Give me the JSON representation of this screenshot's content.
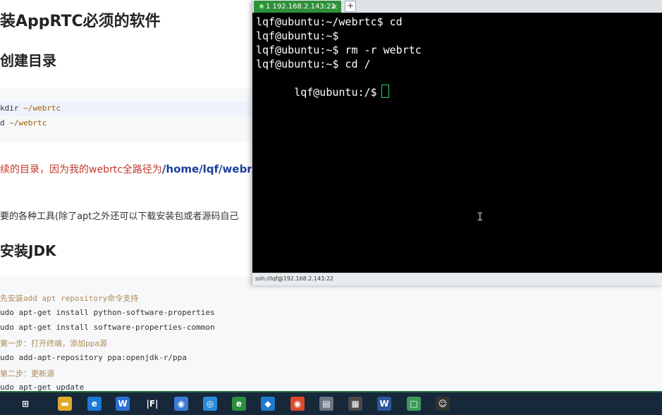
{
  "doc": {
    "heading_main": "装AppRTC必须的软件",
    "heading_dir": "创建目录",
    "dir_code": [
      {
        "cmd": "kdir ",
        "path": "~/webrtc"
      },
      {
        "cmd": "d ",
        "path": "~/webrtc"
      }
    ],
    "red_note": "续的目录，因为我的webrtc全路径为",
    "red_note_path": "/home/lqf/webrtc",
    "note2": "要的各种工具(除了apt之外还可以下载安装包或者源码自己",
    "heading_jdk": "安装JDK",
    "jdk_code": [
      {
        "text": "先安装add apt repository命令支持",
        "comment": true
      },
      {
        "text": "udo apt-get install python-software-properties",
        "comment": false
      },
      {
        "text": "udo apt-get install software-properties-common",
        "comment": false
      },
      {
        "text": "第一步：打开终端，添加ppa源",
        "comment": true
      },
      {
        "text": "udo add-apt-repository ppa:openjdk-r/ppa",
        "comment": false
      },
      {
        "text": "第二步：更新源",
        "comment": true
      },
      {
        "text": "udo apt-get update",
        "comment": false
      }
    ]
  },
  "terminal": {
    "tab_label": "1 192.168.2.143:22",
    "tab_close": "×",
    "tab_add": "+",
    "lines": [
      "lqf@ubuntu:~/webrtc$ cd",
      "lqf@ubuntu:~$",
      "lqf@ubuntu:~$ rm -r webrtc",
      "lqf@ubuntu:~$ cd /",
      "lqf@ubuntu:/$"
    ],
    "status": "ssh://lqf@192.168.2.143:22",
    "ibeam": "I"
  },
  "taskbar": {
    "items": [
      {
        "name": "task-view-icon",
        "glyph": "⊞",
        "color": "#16283a"
      },
      {
        "name": "file-explorer-icon",
        "glyph": "▬",
        "color": "#e0a92c"
      },
      {
        "name": "edge-icon",
        "glyph": "e",
        "color": "#1c78d4"
      },
      {
        "name": "wps-writer-icon",
        "glyph": "W",
        "color": "#2b6fd6"
      },
      {
        "name": "typora-icon",
        "glyph": "|F|",
        "color": "#16283a"
      },
      {
        "name": "browser-blue-icon",
        "glyph": "◉",
        "color": "#3a7bd5"
      },
      {
        "name": "browser-sphere-icon",
        "glyph": "◎",
        "color": "#2a8ad8"
      },
      {
        "name": "ie-icon",
        "glyph": "e",
        "color": "#2a8f3c"
      },
      {
        "name": "vscode-icon",
        "glyph": "◆",
        "color": "#1f7acc"
      },
      {
        "name": "netease-music-icon",
        "glyph": "◉",
        "color": "#d84a2a"
      },
      {
        "name": "screenshot-tool-icon",
        "glyph": "▤",
        "color": "#6a7580"
      },
      {
        "name": "calculator-icon",
        "glyph": "▦",
        "color": "#4a4a4a"
      },
      {
        "name": "word-icon",
        "glyph": "W",
        "color": "#2b579a"
      },
      {
        "name": "app-green-icon",
        "glyph": "□",
        "color": "#3a9a5a"
      },
      {
        "name": "mascot-icon",
        "glyph": "☺",
        "color": "#333333"
      }
    ]
  }
}
